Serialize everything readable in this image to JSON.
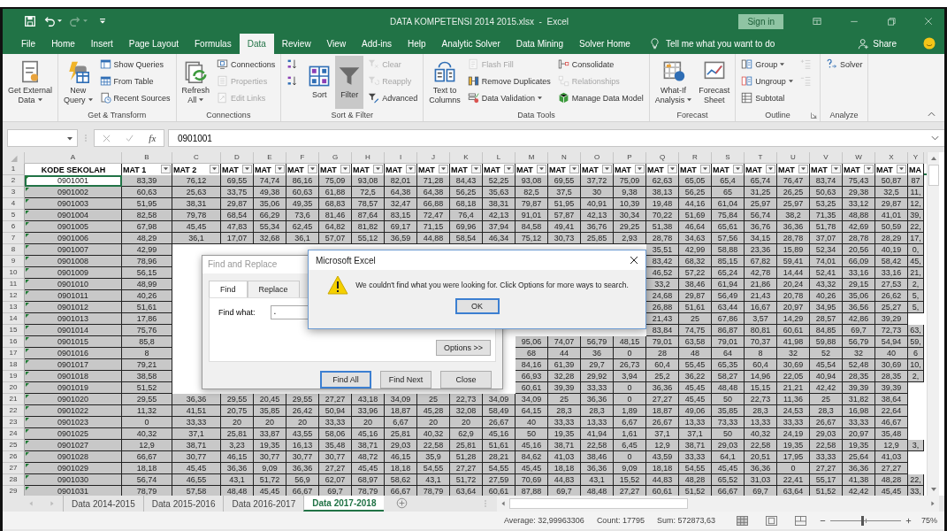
{
  "title_bar": {
    "title": "DATA KOMPETENSI 2014 2015.xlsx  -  Excel",
    "sign_in": "Sign in"
  },
  "menu_tabs": [
    {
      "label": "File",
      "selected": false
    },
    {
      "label": "Home",
      "selected": false
    },
    {
      "label": "Insert",
      "selected": false
    },
    {
      "label": "Page Layout",
      "selected": false
    },
    {
      "label": "Formulas",
      "selected": false
    },
    {
      "label": "Data",
      "selected": true
    },
    {
      "label": "Review",
      "selected": false
    },
    {
      "label": "View",
      "selected": false
    },
    {
      "label": "Add-ins",
      "selected": false
    },
    {
      "label": "Help",
      "selected": false
    },
    {
      "label": "Analytic Solver",
      "selected": false
    },
    {
      "label": "Data Mining",
      "selected": false
    },
    {
      "label": "Solver Home",
      "selected": false
    }
  ],
  "tell_me": "Tell me what you want to do",
  "share": "Share",
  "ribbon": {
    "groups": [
      {
        "items": [
          {
            "label": "Get External\nData",
            "kind": "large",
            "dropdown": true,
            "disabled": false,
            "pressed": false
          }
        ]
      },
      {
        "label": "Get & Transform",
        "items": [
          {
            "label": "New\nQuery",
            "kind": "large",
            "dropdown": true,
            "disabled": false,
            "pressed": false
          },
          {
            "label": "Show Queries",
            "kind": "small",
            "dropdown": false,
            "disabled": false,
            "pressed": false
          },
          {
            "label": "From Table",
            "kind": "small",
            "dropdown": false,
            "disabled": false,
            "pressed": false
          },
          {
            "label": "Recent Sources",
            "kind": "small",
            "dropdown": false,
            "disabled": false,
            "pressed": false
          }
        ]
      },
      {
        "label": "Connections",
        "items": [
          {
            "label": "Refresh\nAll",
            "kind": "large",
            "dropdown": true,
            "disabled": false,
            "pressed": false
          },
          {
            "label": "Connections",
            "kind": "small",
            "dropdown": false,
            "disabled": false,
            "pressed": false
          },
          {
            "label": "Properties",
            "kind": "small",
            "dropdown": false,
            "disabled": true,
            "pressed": false
          },
          {
            "label": "Edit Links",
            "kind": "small",
            "dropdown": false,
            "disabled": true,
            "pressed": false
          }
        ]
      },
      {
        "label": "Sort & Filter",
        "items": [
          {
            "kind": "icon",
            "dropdown": false,
            "disabled": false,
            "pressed": false
          },
          {
            "kind": "icon",
            "dropdown": false,
            "disabled": false,
            "pressed": false
          },
          {
            "label": "Sort",
            "kind": "large",
            "dropdown": false,
            "disabled": false,
            "pressed": false
          },
          {
            "label": "Filter",
            "kind": "large",
            "dropdown": false,
            "disabled": false,
            "pressed": true
          },
          {
            "label": "Clear",
            "kind": "small",
            "dropdown": false,
            "disabled": true,
            "pressed": false
          },
          {
            "label": "Reapply",
            "kind": "small",
            "dropdown": false,
            "disabled": true,
            "pressed": false
          },
          {
            "label": "Advanced",
            "kind": "small",
            "dropdown": false,
            "disabled": false,
            "pressed": false
          }
        ]
      },
      {
        "label": "Data Tools",
        "items": [
          {
            "label": "Text to\nColumns",
            "kind": "large",
            "dropdown": false,
            "disabled": false,
            "pressed": false
          },
          {
            "label": "Flash Fill",
            "kind": "small",
            "dropdown": false,
            "disabled": true,
            "pressed": false
          },
          {
            "label": "Remove Duplicates",
            "kind": "small",
            "dropdown": false,
            "disabled": false,
            "pressed": false
          },
          {
            "label": "Data Validation",
            "kind": "small",
            "dropdown": true,
            "disabled": false,
            "pressed": false
          },
          {
            "label": "Consolidate",
            "kind": "small",
            "dropdown": false,
            "disabled": false,
            "pressed": false
          },
          {
            "label": "Relationships",
            "kind": "small",
            "dropdown": false,
            "disabled": true,
            "pressed": false
          },
          {
            "label": "Manage Data Model",
            "kind": "small",
            "dropdown": false,
            "disabled": false,
            "pressed": false
          }
        ]
      },
      {
        "label": "Forecast",
        "items": [
          {
            "label": "What-If\nAnalysis",
            "kind": "large",
            "dropdown": true,
            "disabled": false,
            "pressed": false
          },
          {
            "label": "Forecast\nSheet",
            "kind": "large",
            "dropdown": false,
            "disabled": false,
            "pressed": false
          }
        ]
      },
      {
        "label": "Outline",
        "launcher": true,
        "items": [
          {
            "label": "Group",
            "kind": "small",
            "dropdown": true,
            "disabled": false,
            "pressed": false
          },
          {
            "label": "Ungroup",
            "kind": "small",
            "dropdown": true,
            "disabled": false,
            "pressed": false
          },
          {
            "label": "Subtotal",
            "kind": "small",
            "dropdown": false,
            "disabled": false,
            "pressed": false
          },
          {
            "kind": "icon",
            "dropdown": false,
            "disabled": true,
            "pressed": false
          },
          {
            "kind": "icon",
            "dropdown": false,
            "disabled": true,
            "pressed": false
          }
        ]
      },
      {
        "label": "Analyze",
        "items": [
          {
            "label": "Solver",
            "kind": "small",
            "dropdown": false,
            "disabled": false,
            "pressed": false
          }
        ]
      }
    ]
  },
  "formula_bar": {
    "fx": "fx",
    "value": "0901001"
  },
  "table": {
    "columns": [
      "A",
      "B",
      "C",
      "D",
      "E",
      "F",
      "G",
      "H",
      "I",
      "J",
      "K",
      "L",
      "M",
      "N",
      "O",
      "P",
      "Q",
      "R",
      "S",
      "T",
      "U",
      "V",
      "W",
      "X",
      "Y"
    ],
    "header_row": {
      "number": "1",
      "cells": [
        {
          "label": "KODE SEKOLAH",
          "filter": false
        },
        {
          "label": "MAT 1",
          "filter": true
        },
        {
          "label": "MAT 2",
          "filter": true
        },
        {
          "label": "MAT",
          "filter": true
        },
        {
          "label": "MAT",
          "filter": true
        },
        {
          "label": "MAT",
          "filter": true
        },
        {
          "label": "MAT",
          "filter": true
        },
        {
          "label": "MAT",
          "filter": true
        },
        {
          "label": "MAT",
          "filter": true
        },
        {
          "label": "MAT",
          "filter": true
        },
        {
          "label": "MAT",
          "filter": true
        },
        {
          "label": "MAT",
          "filter": true
        },
        {
          "label": "MAT",
          "filter": true
        },
        {
          "label": "MAT",
          "filter": true
        },
        {
          "label": "MAT",
          "filter": true
        },
        {
          "label": "MAT",
          "filter": true
        },
        {
          "label": "MAT",
          "filter": true
        },
        {
          "label": "MAT",
          "filter": true
        },
        {
          "label": "MAT",
          "filter": true
        },
        {
          "label": "MAT",
          "filter": true
        },
        {
          "label": "MAT",
          "filter": true
        },
        {
          "label": "MAT",
          "filter": true
        },
        {
          "label": "MAT",
          "filter": true
        },
        {
          "label": "MAT",
          "filter": true
        },
        {
          "label": "MA",
          "filter": false
        }
      ]
    },
    "rows": [
      {
        "number": "2",
        "selected": true,
        "active": true,
        "flagged": true,
        "cells": [
          "0901001",
          "83,39",
          "76,12",
          "69,55",
          "74,74",
          "86,16",
          "75,09",
          "93,08",
          "82,01",
          "71,28",
          "84,43",
          "52,25",
          "93,08",
          "69,55",
          "37,72",
          "75,09",
          "62,63",
          "65,05",
          "65,4",
          "65,74",
          "76,47",
          "83,74",
          "75,43",
          "50,87",
          "87"
        ]
      },
      {
        "number": "3",
        "selected": true,
        "active": false,
        "flagged": true,
        "cells": [
          "0901002",
          "60,63",
          "25,63",
          "33,75",
          "49,38",
          "60,63",
          "61,88",
          "72,5",
          "64,38",
          "64,38",
          "56,25",
          "35,63",
          "82,5",
          "37,5",
          "30",
          "9,38",
          "38,13",
          "56,25",
          "65",
          "31,25",
          "26,25",
          "50,63",
          "29,38",
          "32,5",
          "11,"
        ]
      },
      {
        "number": "4",
        "selected": true,
        "active": false,
        "flagged": true,
        "cells": [
          "0901003",
          "51,95",
          "38,31",
          "29,87",
          "35,06",
          "49,35",
          "68,83",
          "78,57",
          "32,47",
          "66,88",
          "68,18",
          "38,31",
          "79,87",
          "51,95",
          "40,91",
          "10,39",
          "19,48",
          "44,16",
          "61,04",
          "25,97",
          "25,97",
          "53,25",
          "33,12",
          "29,87",
          "12,"
        ]
      },
      {
        "number": "5",
        "selected": true,
        "active": false,
        "flagged": true,
        "cells": [
          "0901004",
          "82,58",
          "79,78",
          "68,54",
          "66,29",
          "73,6",
          "81,46",
          "87,64",
          "83,15",
          "72,47",
          "76,4",
          "42,13",
          "91,01",
          "57,87",
          "42,13",
          "30,34",
          "70,22",
          "51,69",
          "75,84",
          "56,74",
          "38,2",
          "71,35",
          "48,88",
          "41,01",
          "39,"
        ]
      },
      {
        "number": "6",
        "selected": true,
        "active": false,
        "flagged": true,
        "cells": [
          "0901005",
          "67,98",
          "45,45",
          "47,83",
          "55,34",
          "62,45",
          "64,82",
          "81,82",
          "69,17",
          "71,15",
          "69,96",
          "37,94",
          "84,58",
          "49,41",
          "36,76",
          "29,25",
          "51,38",
          "46,64",
          "65,61",
          "36,76",
          "36,36",
          "51,78",
          "42,69",
          "50,59",
          "22,"
        ]
      },
      {
        "number": "7",
        "selected": true,
        "active": false,
        "flagged": true,
        "cells": [
          "0901006",
          "48,29",
          "36,1",
          "17,07",
          "32,68",
          "36,1",
          "57,07",
          "55,12",
          "36,59",
          "44,88",
          "58,54",
          "46,34",
          "75,12",
          "30,73",
          "25,85",
          "2,93",
          "28,78",
          "34,63",
          "57,56",
          "34,15",
          "28,78",
          "37,07",
          "28,78",
          "28,29",
          "17,"
        ]
      },
      {
        "number": "8",
        "selected": true,
        "active": false,
        "flagged": true,
        "cells": [
          "0901007",
          "42,99",
          null,
          null,
          null,
          null,
          null,
          null,
          null,
          null,
          null,
          null,
          null,
          null,
          null,
          null,
          "35,51",
          "42,99",
          "58,88",
          "23,36",
          "15,89",
          "52,34",
          "20,56",
          "40,19",
          "0,"
        ]
      },
      {
        "number": "9",
        "selected": true,
        "active": false,
        "flagged": true,
        "cells": [
          "0901008",
          "78,96",
          null,
          null,
          null,
          null,
          null,
          null,
          null,
          null,
          null,
          null,
          null,
          null,
          null,
          null,
          "83,42",
          "68,32",
          "85,15",
          "67,82",
          "59,41",
          "74,01",
          "66,09",
          "58,42",
          "45,"
        ]
      },
      {
        "number": "10",
        "selected": true,
        "active": false,
        "flagged": true,
        "cells": [
          "0901009",
          "56,15",
          null,
          null,
          null,
          null,
          null,
          null,
          null,
          null,
          null,
          null,
          null,
          null,
          null,
          null,
          "46,52",
          "57,22",
          "65,24",
          "42,78",
          "14,44",
          "52,41",
          "33,16",
          "33,16",
          "21,"
        ]
      },
      {
        "number": "11",
        "selected": true,
        "active": false,
        "flagged": true,
        "cells": [
          "0901010",
          "48,99",
          null,
          null,
          null,
          null,
          null,
          null,
          null,
          null,
          null,
          null,
          null,
          null,
          null,
          null,
          "33,2",
          "38,46",
          "61,94",
          "21,86",
          "20,24",
          "43,32",
          "29,15",
          "27,53",
          "2,"
        ]
      },
      {
        "number": "12",
        "selected": true,
        "active": false,
        "flagged": true,
        "cells": [
          "0901011",
          "40,26",
          null,
          null,
          null,
          null,
          null,
          null,
          null,
          null,
          null,
          null,
          null,
          null,
          null,
          null,
          "24,68",
          "29,87",
          "56,49",
          "21,43",
          "20,78",
          "40,26",
          "35,06",
          "26,62",
          "5,"
        ]
      },
      {
        "number": "13",
        "selected": true,
        "active": false,
        "flagged": true,
        "cells": [
          "0901012",
          "51,61",
          null,
          null,
          null,
          null,
          null,
          null,
          null,
          null,
          null,
          null,
          null,
          null,
          null,
          null,
          "26,88",
          "51,61",
          "63,44",
          "16,67",
          "20,97",
          "34,95",
          "36,56",
          "25,27",
          "5,"
        ]
      },
      {
        "number": "14",
        "selected": true,
        "active": false,
        "flagged": true,
        "cells": [
          "0901013",
          "17,86",
          null,
          null,
          null,
          null,
          null,
          null,
          null,
          null,
          null,
          null,
          null,
          null,
          null,
          null,
          "21,43",
          "25",
          "67,86",
          "3,57",
          "14,29",
          "28,57",
          "42,86",
          "39,29",
          null
        ]
      },
      {
        "number": "15",
        "selected": true,
        "active": false,
        "flagged": true,
        "cells": [
          "0901014",
          "75,76",
          null,
          null,
          null,
          null,
          null,
          null,
          null,
          null,
          null,
          null,
          null,
          null,
          null,
          null,
          "83,84",
          "74,75",
          "86,87",
          "80,81",
          "60,61",
          "84,85",
          "69,7",
          "72,73",
          "63,"
        ]
      },
      {
        "number": "16",
        "selected": true,
        "active": false,
        "flagged": true,
        "cells": [
          "0901015",
          "85,8",
          null,
          null,
          null,
          null,
          null,
          null,
          null,
          null,
          null,
          null,
          "95,06",
          "74,07",
          "56,79",
          "48,15",
          "79,01",
          "63,58",
          "79,01",
          "70,37",
          "41,98",
          "59,88",
          "56,79",
          "54,94",
          "59,"
        ]
      },
      {
        "number": "17",
        "selected": true,
        "active": false,
        "flagged": true,
        "cells": [
          "0901016",
          "8",
          null,
          null,
          null,
          null,
          null,
          null,
          null,
          null,
          null,
          null,
          "68",
          "44",
          "36",
          "0",
          "28",
          "48",
          "64",
          "8",
          "32",
          "52",
          "32",
          "40",
          "6"
        ]
      },
      {
        "number": "18",
        "selected": true,
        "active": false,
        "flagged": true,
        "cells": [
          "0901017",
          "79,21",
          null,
          null,
          null,
          null,
          null,
          null,
          null,
          null,
          null,
          null,
          "84,16",
          "61,39",
          "29,7",
          "26,73",
          "60,4",
          "55,45",
          "65,35",
          "60,4",
          "30,69",
          "45,54",
          "52,48",
          "30,69",
          "10,"
        ]
      },
      {
        "number": "19",
        "selected": true,
        "active": false,
        "flagged": true,
        "cells": [
          "0901018",
          "38,58",
          null,
          null,
          null,
          null,
          null,
          null,
          null,
          null,
          null,
          null,
          "66,93",
          "32,28",
          "29,92",
          "3,94",
          "25,2",
          "36,22",
          "58,27",
          "14,96",
          "22,05",
          "40,94",
          "28,35",
          "28,35",
          "2,"
        ]
      },
      {
        "number": "20",
        "selected": true,
        "active": false,
        "flagged": true,
        "cells": [
          "0901019",
          "51,52",
          null,
          null,
          null,
          null,
          null,
          null,
          null,
          null,
          null,
          null,
          "60,61",
          "39,39",
          "33,33",
          "0",
          "36,36",
          "45,45",
          "48,48",
          "15,15",
          "21,21",
          "42,42",
          "39,39",
          "39,39",
          null
        ]
      },
      {
        "number": "21",
        "selected": true,
        "active": false,
        "flagged": true,
        "cells": [
          "0901020",
          "29,55",
          "36,36",
          "29,55",
          "20,45",
          "29,55",
          "27,27",
          "43,18",
          "34,09",
          "25",
          "22,73",
          "34,09",
          "34,09",
          "25",
          "36,36",
          "0",
          "27,27",
          "45,45",
          "50",
          "22,73",
          "11,36",
          "25",
          "31,82",
          "38,64",
          null
        ]
      },
      {
        "number": "22",
        "selected": true,
        "active": false,
        "flagged": true,
        "cells": [
          "0901022",
          "11,32",
          "41,51",
          "20,75",
          "35,85",
          "26,42",
          "50,94",
          "33,96",
          "18,87",
          "45,28",
          "32,08",
          "58,49",
          "64,15",
          "28,3",
          "28,3",
          "1,89",
          "18,87",
          "49,06",
          "35,85",
          "28,3",
          "24,53",
          "28,3",
          "16,98",
          "22,64",
          null
        ]
      },
      {
        "number": "23",
        "selected": true,
        "active": false,
        "flagged": true,
        "cells": [
          "0901023",
          "0",
          "33,33",
          "20",
          "20",
          "20",
          "33,33",
          "20",
          "6,67",
          "20",
          "20",
          "26,67",
          "40",
          "33,33",
          "13,33",
          "6,67",
          "26,67",
          "13,33",
          "73,33",
          "13,33",
          "33,33",
          "26,67",
          "33,33",
          "46,67",
          null
        ]
      },
      {
        "number": "24",
        "selected": true,
        "active": false,
        "flagged": true,
        "cells": [
          "0901025",
          "40,32",
          "37,1",
          "25,81",
          "33,87",
          "43,55",
          "58,06",
          "45,16",
          "25,81",
          "40,32",
          "62,9",
          "45,16",
          "50",
          "19,35",
          "41,94",
          "1,61",
          "37,1",
          "37,1",
          "50",
          "40,32",
          "24,19",
          "29,03",
          "20,97",
          "35,48",
          null
        ]
      },
      {
        "number": "25",
        "selected": true,
        "active": false,
        "flagged": true,
        "cells": [
          "0901027",
          "12,9",
          "38,71",
          "3,23",
          "19,35",
          "16,13",
          "35,48",
          "38,71",
          "29,03",
          "22,58",
          "25,81",
          "51,61",
          "45,16",
          "38,71",
          "22,58",
          "6,45",
          "12,9",
          "38,71",
          "29,03",
          "22,58",
          "19,35",
          "22,58",
          "19,35",
          "12,9",
          "3,"
        ]
      },
      {
        "number": "26",
        "selected": true,
        "active": false,
        "flagged": true,
        "cells": [
          "0901028",
          "66,67",
          "30,77",
          "46,15",
          "30,77",
          "30,77",
          "30,77",
          "48,72",
          "46,15",
          "35,9",
          "51,28",
          "28,21",
          "84,62",
          "41,03",
          "38,46",
          "0",
          "43,59",
          "33,33",
          "64,1",
          "20,51",
          "17,95",
          "33,33",
          "25,64",
          "41,03",
          null
        ]
      },
      {
        "number": "27",
        "selected": true,
        "active": false,
        "flagged": true,
        "cells": [
          "0901029",
          "18,18",
          "45,45",
          "36,36",
          "9,09",
          "36,36",
          "27,27",
          "45,45",
          "18,18",
          "54,55",
          "27,27",
          "54,55",
          "45,45",
          "18,18",
          "36,36",
          "9,09",
          "18,18",
          "54,55",
          "45,45",
          "36,36",
          "0",
          "27,27",
          "36,36",
          "27,27",
          null
        ]
      },
      {
        "number": "28",
        "selected": true,
        "active": false,
        "flagged": true,
        "cells": [
          "0901030",
          "56,74",
          "46,55",
          "43,1",
          "51,72",
          "56,9",
          "62,07",
          "68,97",
          "58,62",
          "43,1",
          "51,72",
          "27,59",
          "70,69",
          "44,83",
          "43,1",
          "15,52",
          "44,83",
          "48,28",
          "65,52",
          "31,03",
          "22,41",
          "55,17",
          "41,38",
          "48,28",
          "22,"
        ]
      },
      {
        "number": "29",
        "selected": true,
        "active": false,
        "flagged": true,
        "cells": [
          "0901031",
          "78,79",
          "57,58",
          "48,48",
          "45,45",
          "66,67",
          "69,7",
          "78,79",
          "66,67",
          "78,79",
          "63,64",
          "60,61",
          "87,88",
          "69,7",
          "48,48",
          "27,27",
          "60,61",
          "51,52",
          "66,67",
          "69,7",
          "63,64",
          "51,52",
          "42,42",
          "45,45",
          "33,"
        ]
      }
    ]
  },
  "sheet_tabs": [
    {
      "label": "Data 2014-2015",
      "selected": false
    },
    {
      "label": "Data 2015-2016",
      "selected": false
    },
    {
      "label": "Data 2016-2017",
      "selected": false
    },
    {
      "label": "Data 2017-2018",
      "selected": true
    }
  ],
  "status_bar": {
    "average": "Average: 32,99963306",
    "count": "Count: 17795",
    "sum": "Sum: 572873,63",
    "zoom": {
      "level": 0.45,
      "reading": "75%"
    }
  },
  "find_dialog": {
    "title": "Find and Replace",
    "tabs": [
      {
        "label": "Find",
        "selected": true
      },
      {
        "label": "Replace",
        "selected": false
      }
    ],
    "field_label": "Find what:",
    "value": ".",
    "options": "Options >>",
    "buttons": [
      {
        "label": "Find All",
        "default": true
      },
      {
        "label": "Find Next",
        "default": false
      },
      {
        "label": "Close",
        "default": false
      }
    ]
  },
  "alert_dialog": {
    "title": "Microsoft Excel",
    "message": "We couldn't find what you were looking for. Click Options for more ways to search.",
    "button": "OK"
  }
}
